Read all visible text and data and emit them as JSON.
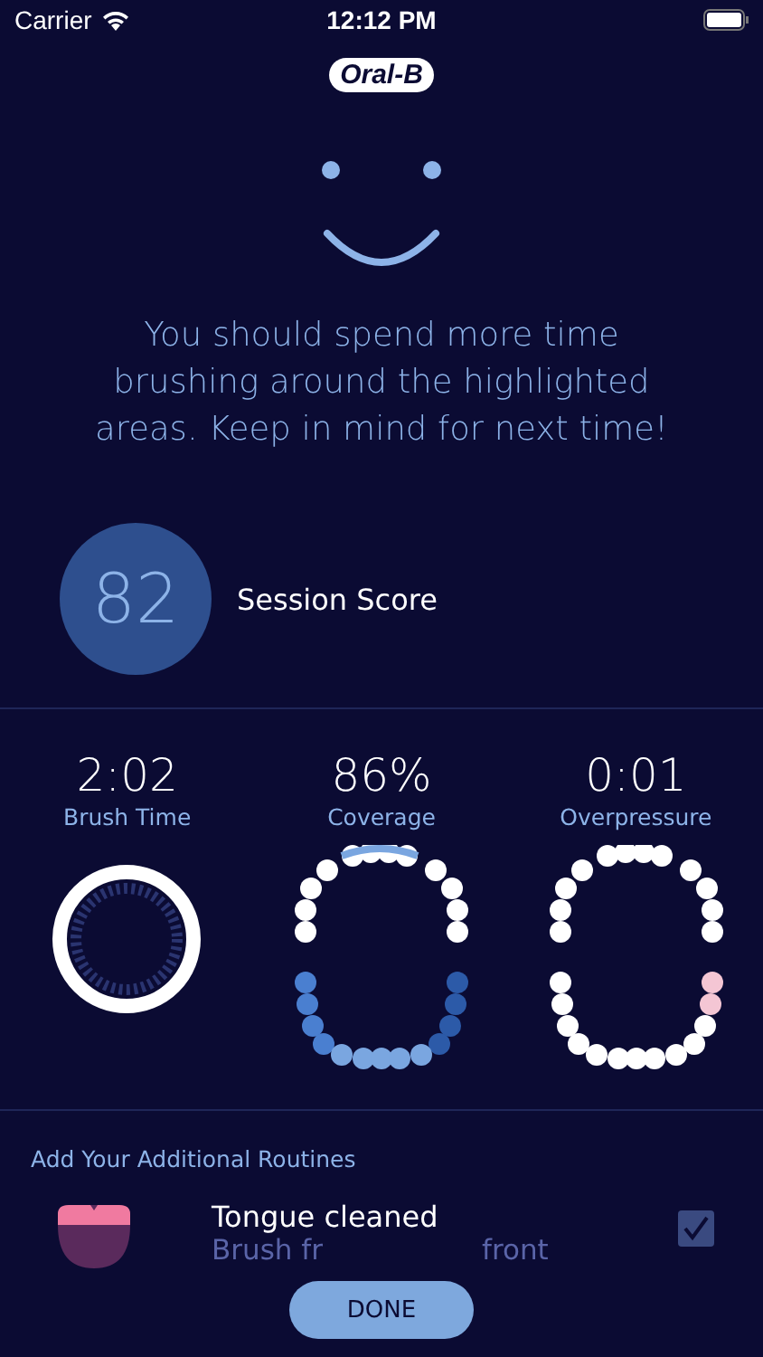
{
  "status_bar": {
    "carrier": "Carrier",
    "time": "12:12 PM"
  },
  "logo": "Oral-B",
  "message": "You should spend more time brushing around the highlighted areas. Keep in mind for next time!",
  "score": {
    "value": "82",
    "label": "Session Score"
  },
  "stats": [
    {
      "kind": "timer",
      "value": "2:02",
      "label": "Brush Time"
    },
    {
      "kind": "coverage",
      "value": "86%",
      "label": "Coverage"
    },
    {
      "kind": "pressure",
      "value": "0:01",
      "label": "Overpressure"
    }
  ],
  "routines": {
    "title": "Add Your Additional Routines",
    "items": [
      {
        "title": "Tongue cleaned",
        "subtitle_parts": [
          "Brush fr",
          "front"
        ],
        "checked": true
      }
    ]
  },
  "done_button": "DONE"
}
